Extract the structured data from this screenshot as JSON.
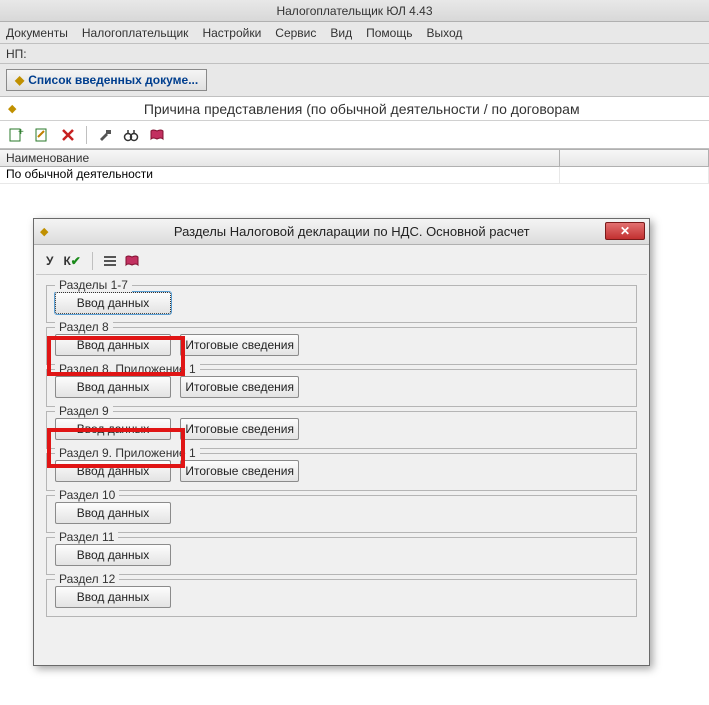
{
  "app": {
    "title": "Налогоплательщик ЮЛ 4.43"
  },
  "menu": {
    "items": [
      "Документы",
      "Налогоплательщик",
      "Настройки",
      "Сервис",
      "Вид",
      "Помощь",
      "Выход"
    ]
  },
  "np_label": "НП:",
  "tab_button": "Список введенных докуме...",
  "heading": "Причина представления (по обычной деятельности / по договорам",
  "grid": {
    "headers": [
      "Наименование",
      ""
    ],
    "row": "По обычной деятельности"
  },
  "dialog": {
    "title": "Разделы Налоговой декларации по НДС. Основной расчет",
    "toolbar": {
      "u": "У",
      "k": "К"
    },
    "sections": [
      {
        "legend": "Разделы 1-7",
        "buttons": [
          "Ввод данных"
        ],
        "focused": true
      },
      {
        "legend": "Раздел 8",
        "buttons": [
          "Ввод данных",
          "Итоговые сведения"
        ]
      },
      {
        "legend": "Раздел 8. Приложение 1",
        "buttons": [
          "Ввод данных",
          "Итоговые сведения"
        ]
      },
      {
        "legend": "Раздел 9",
        "buttons": [
          "Ввод данных",
          "Итоговые сведения"
        ]
      },
      {
        "legend": "Раздел 9. Приложение 1",
        "buttons": [
          "Ввод данных",
          "Итоговые сведения"
        ]
      },
      {
        "legend": "Раздел 10",
        "buttons": [
          "Ввод данных"
        ]
      },
      {
        "legend": "Раздел 11",
        "buttons": [
          "Ввод данных"
        ]
      },
      {
        "legend": "Раздел 12",
        "buttons": [
          "Ввод данных"
        ]
      }
    ]
  }
}
